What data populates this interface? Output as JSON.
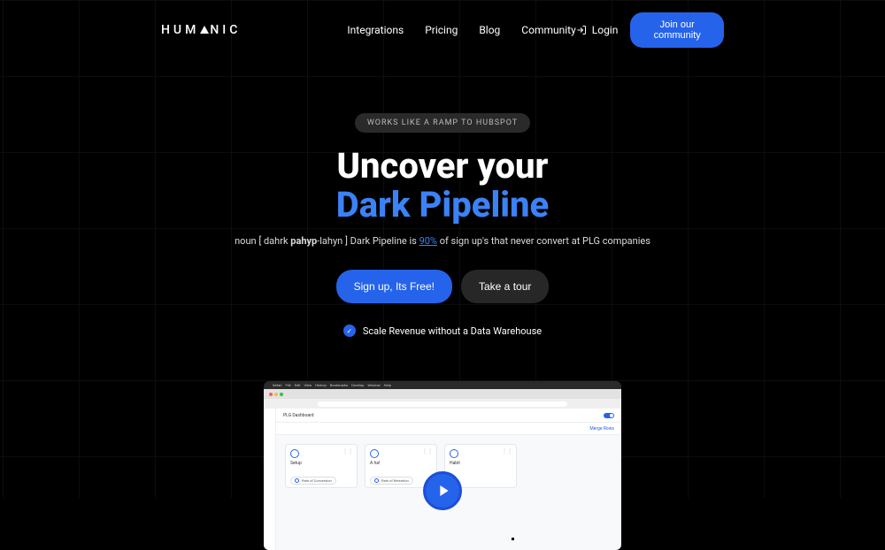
{
  "logo": {
    "pre": "HUM",
    "post": "NIC"
  },
  "nav": {
    "integrations": "Integrations",
    "pricing": "Pricing",
    "blog": "Blog",
    "community": "Community"
  },
  "header": {
    "login": "Login",
    "cta": "Join our community"
  },
  "hero": {
    "badge": "WORKS LIKE A RAMP TO HUBSPOT",
    "title_line1": "Uncover your",
    "title_line2": "Dark Pipeline",
    "sub_pre": "noun [ dahrk ",
    "sub_bold": "pahyp",
    "sub_mid": "-lahyn ] Dark Pipeline is ",
    "sub_pct": "90%",
    "sub_post": " of sign up's that never convert at PLG companies",
    "cta_primary": "Sign up, Its Free!",
    "cta_secondary": "Take a tour",
    "feature": "Scale Revenue without a Data Warehouse"
  },
  "video": {
    "mac_menus": [
      "Safari",
      "File",
      "Edit",
      "View",
      "History",
      "Bookmarks",
      "Develop",
      "Window",
      "Help"
    ],
    "dashboard_title": "PLG Dashboard",
    "merge_link": "Merge Rows",
    "cards": [
      {
        "title": "Setup",
        "pill": "Rate of Conversion"
      },
      {
        "title": "A ha!",
        "pill": "Rate of Retention"
      },
      {
        "title": "Habit",
        "pill": ""
      }
    ]
  }
}
